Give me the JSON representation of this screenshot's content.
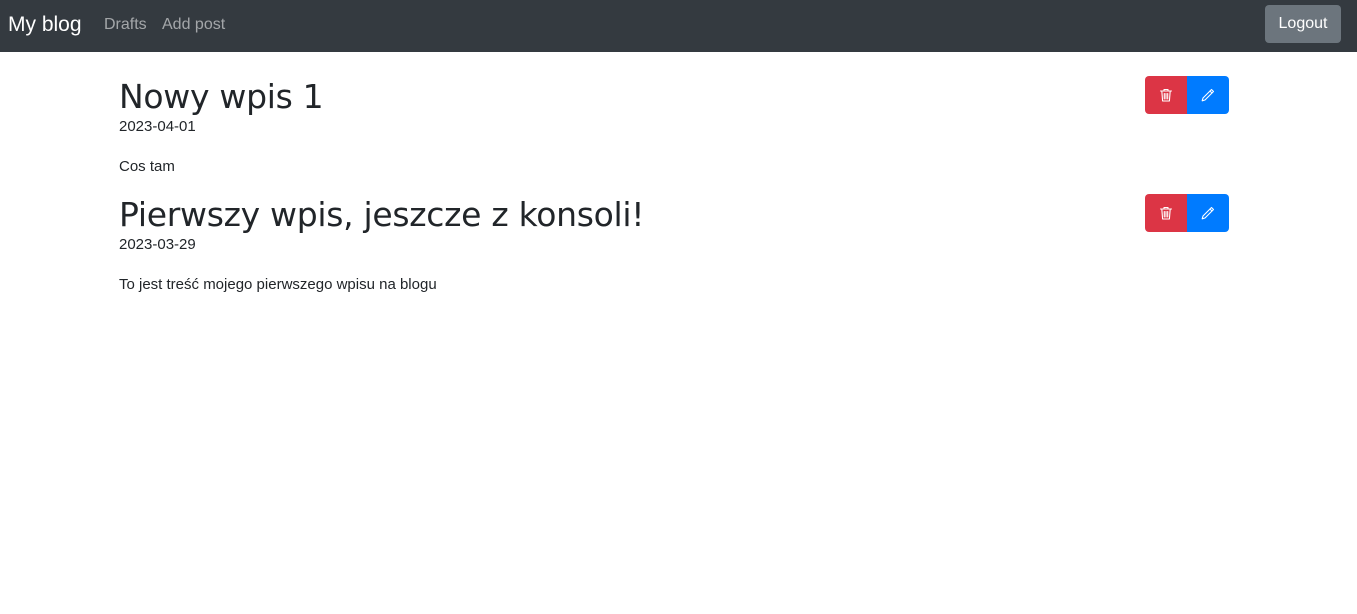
{
  "navbar": {
    "brand": "My blog",
    "links": [
      {
        "label": "Drafts"
      },
      {
        "label": "Add post"
      }
    ],
    "logout_label": "Logout"
  },
  "posts": [
    {
      "title": "Nowy wpis 1",
      "date": "2023-04-01",
      "body": "Cos tam",
      "actions": {
        "delete_icon": "trash-icon",
        "edit_icon": "pencil-icon"
      }
    },
    {
      "title": "Pierwszy wpis, jeszcze z konsoli!",
      "date": "2023-03-29",
      "body": "To jest treść mojego pierwszego wpisu na blogu",
      "actions": {
        "delete_icon": "trash-icon",
        "edit_icon": "pencil-icon"
      }
    }
  ],
  "colors": {
    "navbar_bg": "#343a40",
    "logout_bg": "#6c757d",
    "delete_bg": "#dc3545",
    "edit_bg": "#007bff",
    "text": "#212529"
  }
}
